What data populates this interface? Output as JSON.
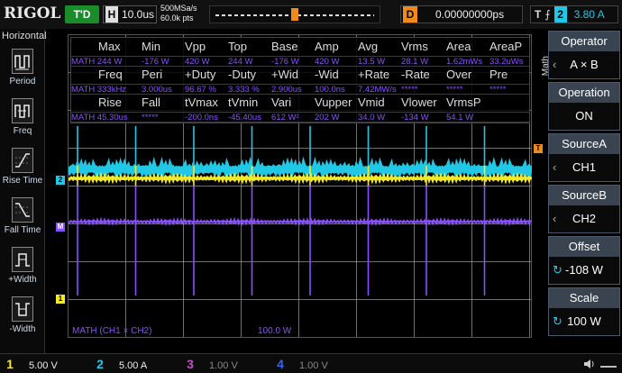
{
  "topbar": {
    "logo": "RIGOL",
    "mode": "T'D",
    "horizontal_label": "H",
    "timebase": "10.0us",
    "sample_rate": "500MSa/s",
    "memory_depth": "60.0k pts",
    "delay_label": "D",
    "delay_value": "0.00000000ps",
    "trigger_label": "T",
    "trigger_channel": "2",
    "trigger_level": "3.80 A"
  },
  "left_panel": {
    "title": "Horizontal",
    "items": [
      {
        "label": "Period"
      },
      {
        "label": "Freq"
      },
      {
        "label": "Rise Time"
      },
      {
        "label": "Fall Time"
      },
      {
        "label": "+Width"
      },
      {
        "label": "-Width"
      }
    ]
  },
  "measurements": {
    "headers1": [
      "Max",
      "Min",
      "Vpp",
      "Top",
      "Base",
      "Amp",
      "Avg",
      "Vrms",
      "Area",
      "AreaP"
    ],
    "values1": [
      "MATH 244 W",
      "-176 W",
      "420 W",
      "244 W",
      "-176 W",
      "420 W",
      "13.5 W",
      "28.1 W",
      "1.62mWs",
      "33.2uWs"
    ],
    "headers2": [
      "Freq",
      "Peri",
      "+Duty",
      "-Duty",
      "+Wid",
      "-Wid",
      "+Rate",
      "-Rate",
      "Over",
      "Pre"
    ],
    "values2": [
      "MATH 333kHz",
      "3.000us",
      "96.67 %",
      "3.333 %",
      "2.900us",
      "100.0ns",
      "7.42MW/s",
      "*****",
      "*****",
      "*****"
    ],
    "headers3": [
      "Rise",
      "Fall",
      "tVmax",
      "tVmin",
      "Vari",
      "Vupper",
      "Vmid",
      "Vlower",
      "VrmsP"
    ],
    "values3": [
      "MATH 45.30us",
      "*****",
      "-200.0ns",
      "-45.40us",
      "612 W²",
      "202 W",
      "34.0 W",
      "-134 W",
      "54.1 W"
    ]
  },
  "waveform": {
    "ch1_marker": "1",
    "ch2_marker": "2",
    "math_marker": "M",
    "trigger_marker": "T",
    "math_expression": "MATH (CH1 × CH2)",
    "math_scale": "100.0 W"
  },
  "right_panel": {
    "menu_title": "Math",
    "buttons": [
      {
        "title": "Operator",
        "value": "A × B"
      },
      {
        "title": "Operation",
        "value": "ON"
      },
      {
        "title": "SourceA",
        "value": "CH1"
      },
      {
        "title": "SourceB",
        "value": "CH2"
      },
      {
        "title": "Offset",
        "value": "-108 W"
      },
      {
        "title": "Scale",
        "value": "100 W"
      }
    ]
  },
  "bottom_bar": {
    "channels": [
      {
        "num": "1",
        "scale": "5.00 V",
        "color": "#f2e92a"
      },
      {
        "num": "2",
        "scale": "5.00 A",
        "color": "#21c8e6"
      },
      {
        "num": "3",
        "scale": "1.00 V",
        "color": "#c04fc0"
      },
      {
        "num": "4",
        "scale": "1.00 V",
        "color": "#3a66e0"
      }
    ]
  },
  "colors": {
    "ch1": "#f2e92a",
    "ch2": "#21c8e6",
    "math": "#8a4fff",
    "trigger": "#f08a1c"
  }
}
